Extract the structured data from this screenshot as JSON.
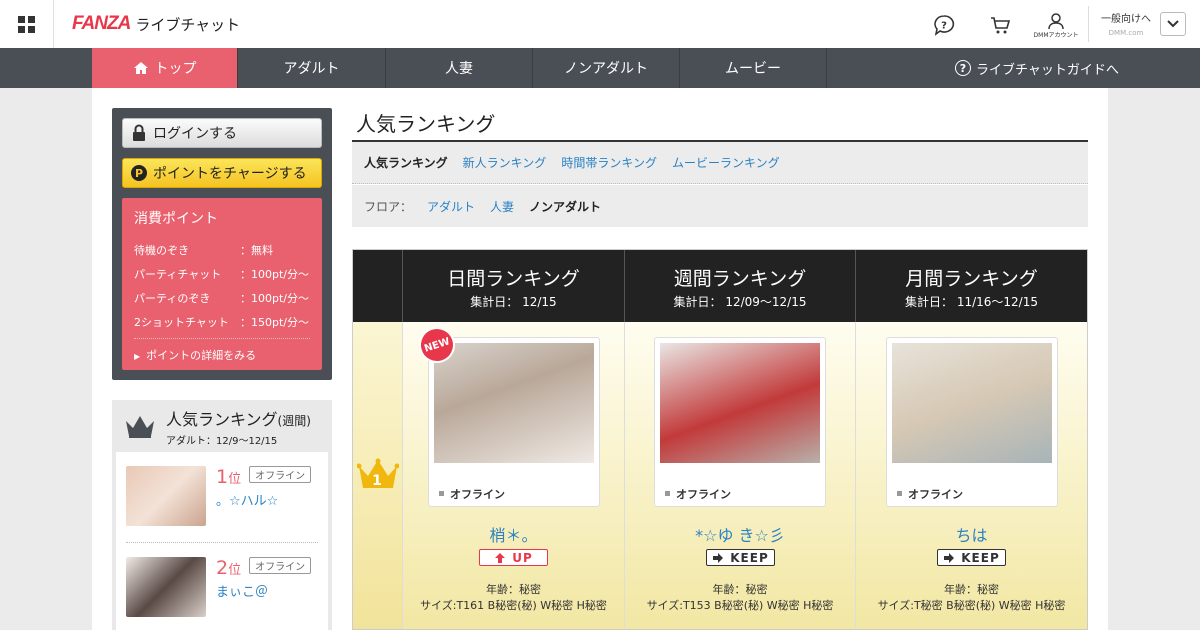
{
  "header": {
    "brand": "FANZA",
    "service": "ライブチャット",
    "account_label": "DMMアカウント",
    "genre_label": "一般向けへ",
    "genre_sub": "DMM.com",
    "icons": [
      "grid-menu-icon",
      "help-icon",
      "cart-icon",
      "account-icon",
      "chevron-down-icon"
    ]
  },
  "nav": {
    "items": [
      {
        "label": "トップ",
        "active": true
      },
      {
        "label": "アダルト"
      },
      {
        "label": "人妻"
      },
      {
        "label": "ノンアダルト"
      },
      {
        "label": "ムービー"
      }
    ],
    "guide": "ライブチャットガイドへ"
  },
  "sidebar": {
    "login": "ログインする",
    "charge": "ポイントをチャージする",
    "points": {
      "title": "消費ポイント",
      "rows": [
        {
          "label": "待機のぞき",
          "value": "：無料"
        },
        {
          "label": "パーティチャット",
          "value": "：100pt/分～"
        },
        {
          "label": "パーティのぞき",
          "value": "：100pt/分～"
        },
        {
          "label": "2ショットチャット",
          "value": "：150pt/分～"
        }
      ],
      "more": "ポイントの詳細をみる"
    },
    "ranking": {
      "title": "人気ランキング",
      "title_suffix": "(週間)",
      "period": "アダルト：12/9～12/15",
      "entries": [
        {
          "rank": "1",
          "unit": "位",
          "status": "オフライン",
          "name": "。☆ハル☆"
        },
        {
          "rank": "2",
          "unit": "位",
          "status": "オフライン",
          "name": "まぃこ＠"
        }
      ]
    }
  },
  "main": {
    "title": "人気ランキング",
    "tabs": [
      "人気ランキング",
      "新人ランキング",
      "時間帯ランキング",
      "ムービーランキング"
    ],
    "floor_label": "フロア：",
    "floors": [
      "アダルト",
      "人妻",
      "ノンアダルト"
    ],
    "columns": [
      {
        "title": "日間ランキング",
        "date": "集計日： 12/15"
      },
      {
        "title": "週間ランキング",
        "date": "集計日： 12/09～12/15"
      },
      {
        "title": "月間ランキング",
        "date": "集計日： 11/16～12/15"
      }
    ],
    "rank1": {
      "crown_number": "1",
      "performers": [
        {
          "name": "梢＊。",
          "status": "オフライン",
          "trend": "UP",
          "new": "NEW",
          "age": "年齢：秘密",
          "size": "サイズ:T161 B秘密(秘) W秘密 H秘密"
        },
        {
          "name": "*☆ゆ き☆彡",
          "status": "オフライン",
          "trend": "KEEP",
          "age": "年齢：秘密",
          "size": "サイズ:T153 B秘密(秘) W秘密 H秘密"
        },
        {
          "name": "ちは",
          "status": "オフライン",
          "trend": "KEEP",
          "age": "年齢：秘密",
          "size": "サイズ:T秘密 B秘密(秘) W秘密 H秘密"
        }
      ]
    }
  },
  "colors": {
    "accent": "#e9616e",
    "brand": "#e8374b",
    "link": "#2a82c5",
    "nav": "#4a4e55"
  }
}
